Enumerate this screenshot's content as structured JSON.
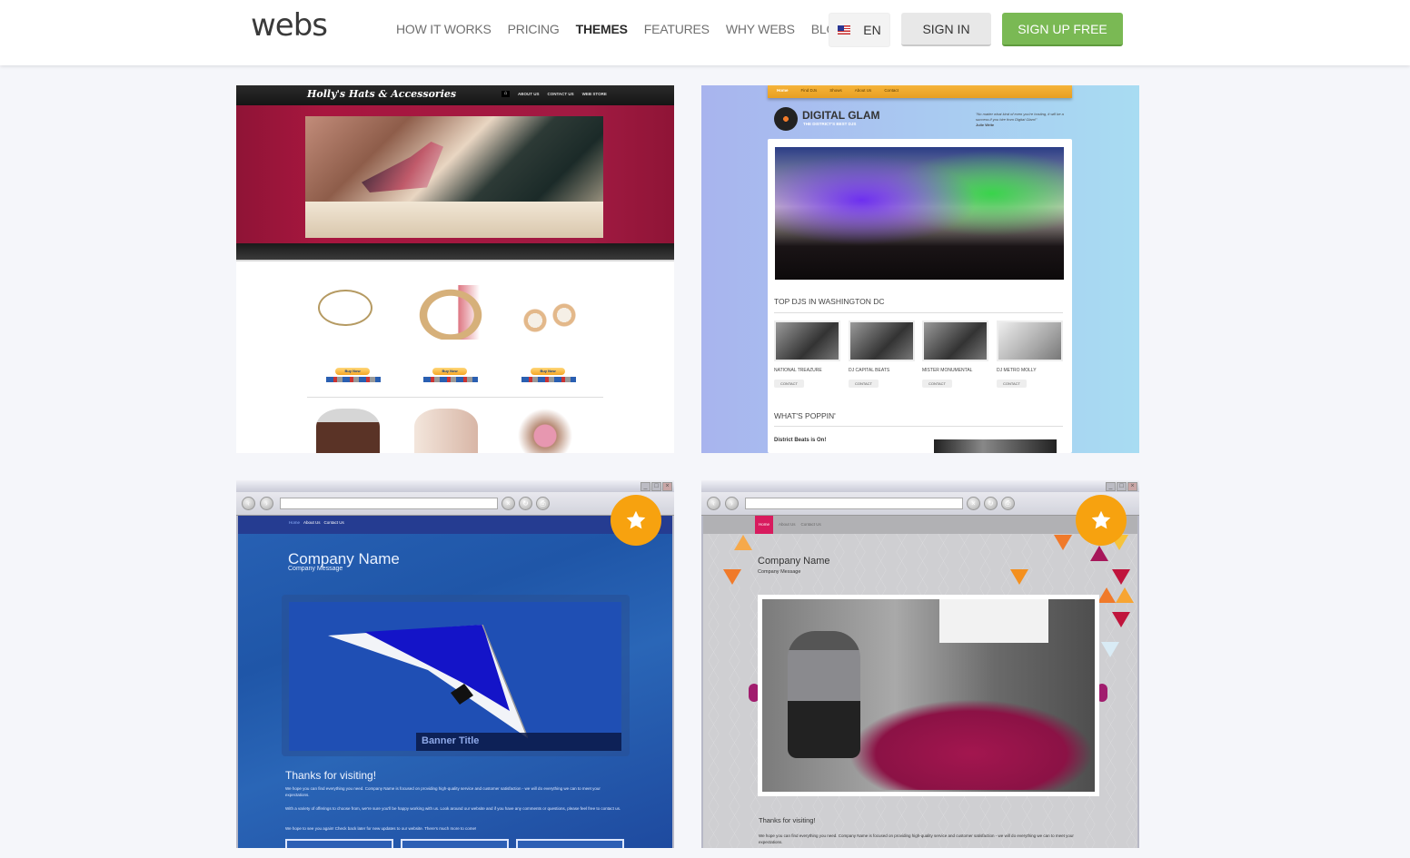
{
  "header": {
    "logo": "webs",
    "nav": [
      {
        "label": "HOW IT WORKS",
        "active": false
      },
      {
        "label": "PRICING",
        "active": false
      },
      {
        "label": "THEMES",
        "active": true
      },
      {
        "label": "FEATURES",
        "active": false
      },
      {
        "label": "WHY WEBS",
        "active": false
      },
      {
        "label": "BLOG",
        "active": false
      }
    ],
    "language": {
      "flag_icon": "us-flag-icon",
      "code": "EN"
    },
    "sign_in_label": "SIGN IN",
    "sign_up_label": "SIGN UP FREE",
    "colors": {
      "signup_bg": "#7ab954",
      "signin_bg": "#e8e8e8",
      "star_badge": "#f7a20f"
    }
  },
  "themes": [
    {
      "name": "Holly's Hats & Accessories",
      "nav": [
        "ABOUT US",
        "CONTACT US",
        "WEB STORE"
      ],
      "buy_label": "Buy Now",
      "featured": false
    },
    {
      "name": "DIGITAL GLAM",
      "tagline": "THE DISTRICT'S BEST DJS",
      "nav": [
        "Home",
        "Find DJs",
        "Shows",
        "About Us",
        "Contact"
      ],
      "quote": "\"No matter what kind of even you're hosting, it will be a success if you hire from Digital Glam!\"",
      "quote_author": "Julie Write",
      "section1_title": "TOP DJS IN WASHINGTON DC",
      "djs": [
        "NATIONAL TREAZURE",
        "DJ CAPITAL BEATS",
        "MISTER MONUMENTAL",
        "DJ METRO MOLLY"
      ],
      "contact_label": "CONTACT",
      "section2_title": "WHAT'S POPPIN'",
      "news_title": "District Beats is On!",
      "featured": false
    },
    {
      "name": "Company Name",
      "message": "Company Message",
      "nav": [
        "Home",
        "About Us",
        "Contact Us"
      ],
      "banner_title": "Banner Title",
      "thanks": "Thanks for visiting!",
      "paragraphs": [
        "We hope you can find everything you need. Company Name is focused on providing high-quality service and customer satisfaction - we will do everything we can to meet your expectations.",
        "With a variety of offerings to choose from, we're sure you'll be happy working with us. Look around our website and if you have any comments or questions, please feel free to contact us.",
        "We hope to see you again! Check back later for new updates to our website. There's much more to come!"
      ],
      "featured": true
    },
    {
      "name": "Company Name",
      "message": "Company Message",
      "nav": [
        "Home",
        "About Us",
        "Contact Us"
      ],
      "thanks": "Thanks for visiting!",
      "paragraphs": [
        "We hope you can find everything you need. Company Name is focused on providing high-quality service and customer satisfaction - we will do everything we can to meet your expectations."
      ],
      "featured": true
    }
  ]
}
